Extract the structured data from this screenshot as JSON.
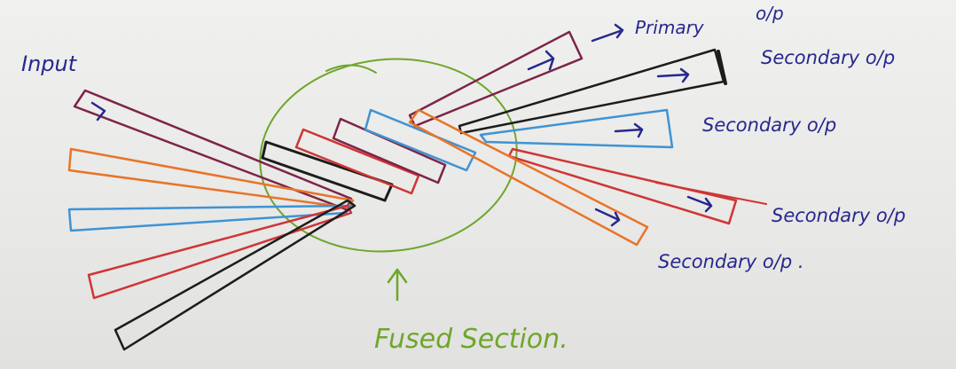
{
  "labels": {
    "input": "Input",
    "primary": "Primary",
    "primary_op": "o/p",
    "secondary_1": "Secondary o/p",
    "secondary_2": "Secondary o/p",
    "secondary_3": "Secondary o/p",
    "secondary_4": "Secondary o/p .",
    "fused": "Fused Section."
  },
  "colors": {
    "ink": "#27278f",
    "green": "#6fa62c",
    "purple": "#7d2448",
    "orange": "#e8742a",
    "blue": "#3f93d4",
    "red": "#cf3535",
    "black": "#1c1c1c"
  }
}
